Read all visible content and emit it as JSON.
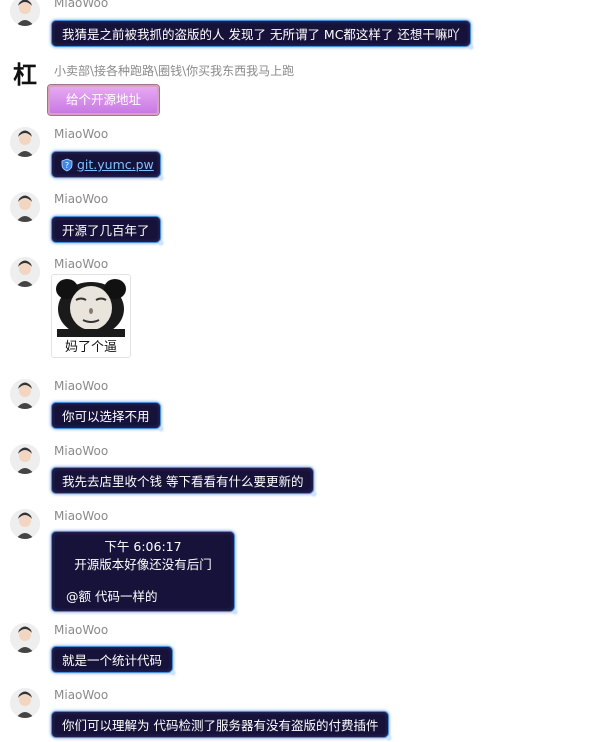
{
  "messages": [
    {
      "sender": "MiaoWoo",
      "text": "我猜是之前被我抓的盗版的人 发现了 无所谓了 MC都这样了 还想干嘛吖"
    },
    {
      "sender": "小卖部\\接各种跑路\\圈钱\\你买我东西我马上跑",
      "avatar_char": "杠",
      "text": "给个开源地址"
    },
    {
      "sender": "MiaoWoo",
      "link": "git.yumc.pw",
      "icon": "shield-icon"
    },
    {
      "sender": "MiaoWoo",
      "text": "开源了几百年了"
    },
    {
      "sender": "MiaoWoo",
      "sticker_caption": "妈了个逼"
    },
    {
      "sender": "MiaoWoo",
      "text": "你可以选择不用"
    },
    {
      "sender": "MiaoWoo",
      "text": "我先去店里收个钱 等下看看有什么要更新的"
    },
    {
      "sender": "MiaoWoo",
      "quote_time": "下午 6:06:17",
      "quote_text": "开源版本好像还没有后门",
      "reply": "@额 代码一样的"
    },
    {
      "sender": "MiaoWoo",
      "text": "就是一个统计代码"
    },
    {
      "sender": "MiaoWoo",
      "text": "你们可以理解为 代码检测了服务器有没有盗版的付费插件"
    }
  ]
}
